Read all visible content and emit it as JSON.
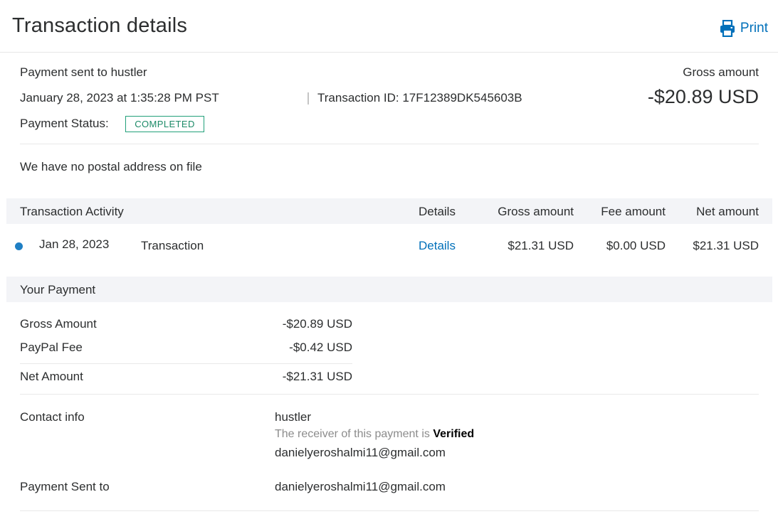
{
  "header": {
    "title": "Transaction details",
    "print_label": "Print",
    "print_icon": "printer-icon",
    "accent_color": "#0070ba"
  },
  "summary": {
    "payment_sent_to": "Payment sent to hustler",
    "datetime": "January 28, 2023 at 1:35:28 PM PST",
    "transaction_id": "Transaction ID: 17F12389DK545603B",
    "status_label": "Payment Status:",
    "status_value": "COMPLETED",
    "status_color": "#22a07a",
    "gross_label": "Gross amount",
    "gross_value": "-$20.89 USD"
  },
  "address_note": "We have no postal address on file",
  "activity": {
    "title": "Transaction Activity",
    "columns": {
      "details": "Details",
      "gross": "Gross amount",
      "fee": "Fee amount",
      "net": "Net amount"
    },
    "rows": [
      {
        "date": "Jan 28, 2023",
        "type": "Transaction",
        "details": "Details",
        "gross": "$21.31 USD",
        "fee": "$0.00 USD",
        "net": "$21.31 USD"
      }
    ]
  },
  "payment": {
    "title": "Your Payment",
    "items": [
      {
        "label": "Gross Amount",
        "value": "-$20.89 USD"
      },
      {
        "label": "PayPal Fee",
        "value": "-$0.42 USD"
      },
      {
        "label": "Net Amount",
        "value": "-$21.31 USD"
      }
    ]
  },
  "contact": {
    "label": "Contact info",
    "name": "hustler",
    "verified_prefix": "The receiver of this payment is",
    "verified_word": "Verified",
    "email": "danielyeroshalmi11@gmail.com"
  },
  "sent_to": {
    "label": "Payment Sent to",
    "email": "danielyeroshalmi11@gmail.com"
  }
}
